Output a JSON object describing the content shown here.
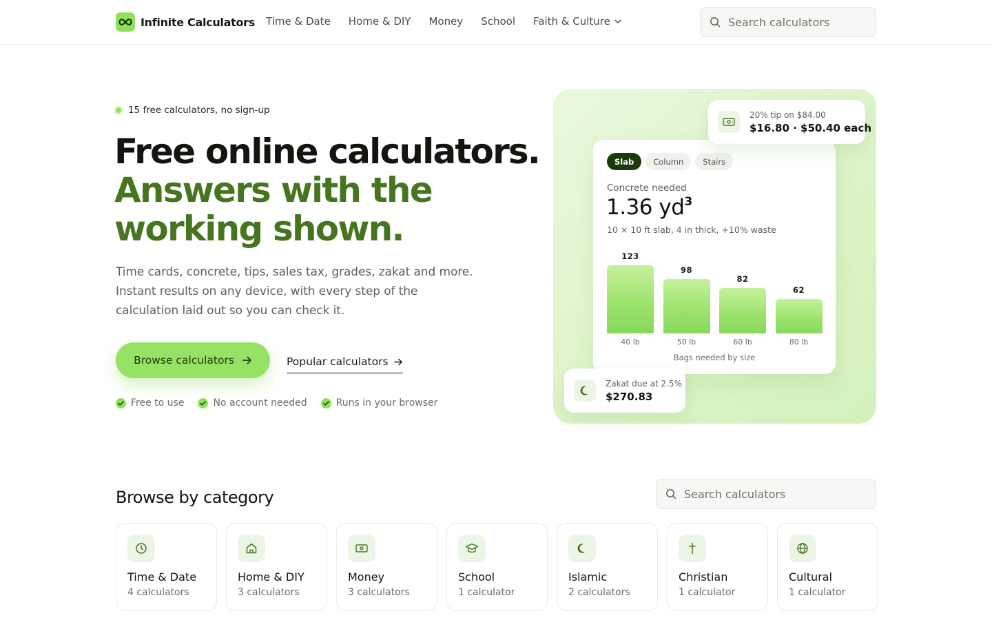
{
  "header": {
    "brand": "Infinite Calculators",
    "nav": [
      "Time & Date",
      "Home & DIY",
      "Money",
      "School",
      "Faith & Culture"
    ],
    "search_placeholder": "Search calculators"
  },
  "hero": {
    "badge": "15 free calculators, no sign-up",
    "title_line1": "Free online calculators.",
    "title_line2": "Answers with the working shown.",
    "description": "Time cards, concrete, tips, sales tax, grades, zakat and more. Instant results on any device, with every step of the calculation laid out so you can check it.",
    "primary_button": "Browse calculators",
    "secondary_link": "Popular calculators",
    "features": [
      "Free to use",
      "No account needed",
      "Runs in your browser"
    ]
  },
  "preview": {
    "tabs": [
      "Slab",
      "Column",
      "Stairs"
    ],
    "active_tab": "Slab",
    "label": "Concrete needed",
    "value": "1.36 yd",
    "value_sup": "3",
    "note": "10 × 10 ft slab, 4 in thick, +10% waste",
    "caption": "Bags needed by size",
    "tip": {
      "label": "20% tip on $84.00",
      "value": "$16.80 · $50.40 each"
    },
    "zakat": {
      "label": "Zakat due at 2.5%",
      "value": "$270.83"
    }
  },
  "chart_data": {
    "type": "bar",
    "categories": [
      "40 lb",
      "50 lb",
      "60 lb",
      "80 lb"
    ],
    "values": [
      123,
      98,
      82,
      62
    ],
    "xlabel": "Bags needed by size",
    "ylim": [
      0,
      123
    ]
  },
  "browse": {
    "title": "Browse by category",
    "search_placeholder": "Search calculators",
    "categories": [
      {
        "name": "Time & Date",
        "count": "4 calculators",
        "icon": "clock-icon"
      },
      {
        "name": "Home & DIY",
        "count": "3 calculators",
        "icon": "home-icon"
      },
      {
        "name": "Money",
        "count": "3 calculators",
        "icon": "banknote-icon"
      },
      {
        "name": "School",
        "count": "1 calculator",
        "icon": "graduation-cap-icon"
      },
      {
        "name": "Islamic",
        "count": "2 calculators",
        "icon": "crescent-moon-icon"
      },
      {
        "name": "Christian",
        "count": "1 calculator",
        "icon": "cross-icon"
      },
      {
        "name": "Cultural",
        "count": "1 calculator",
        "icon": "globe-icon"
      }
    ]
  },
  "colors": {
    "accent": "#8fe05a",
    "accent_dark": "#467520",
    "dark_green": "#1c3a09"
  }
}
